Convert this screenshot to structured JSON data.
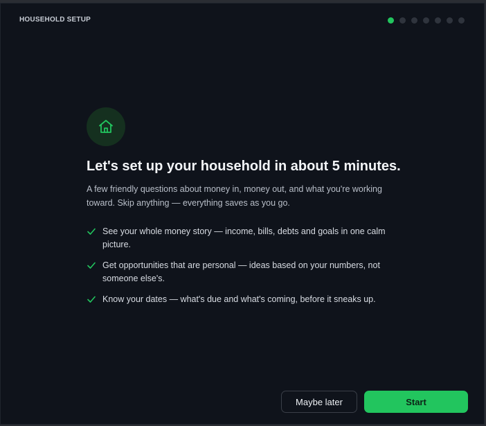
{
  "header": {
    "title": "HOUSEHOLD SETUP"
  },
  "progress": {
    "total_steps": 7,
    "current_step": 1
  },
  "hero": {
    "icon": "house-icon",
    "title": "Let's set up your household in about 5 minutes.",
    "subtitle": "A few friendly questions about money in, money out, and what you're working toward. Skip anything — everything saves as you go."
  },
  "benefits": [
    {
      "icon": "check-icon",
      "text": "See your whole money story — income, bills, debts and goals in one calm picture."
    },
    {
      "icon": "check-icon",
      "text": "Get opportunities that are personal — ideas based on your numbers, not someone else's."
    },
    {
      "icon": "check-icon",
      "text": "Know your dates — what's due and what's coming, before it sneaks up."
    }
  ],
  "actions": {
    "secondary_label": "Maybe later",
    "primary_label": "Start"
  },
  "colors": {
    "accent": "#22c55e",
    "background": "#0f131b",
    "icon_bg": "#15301f"
  }
}
